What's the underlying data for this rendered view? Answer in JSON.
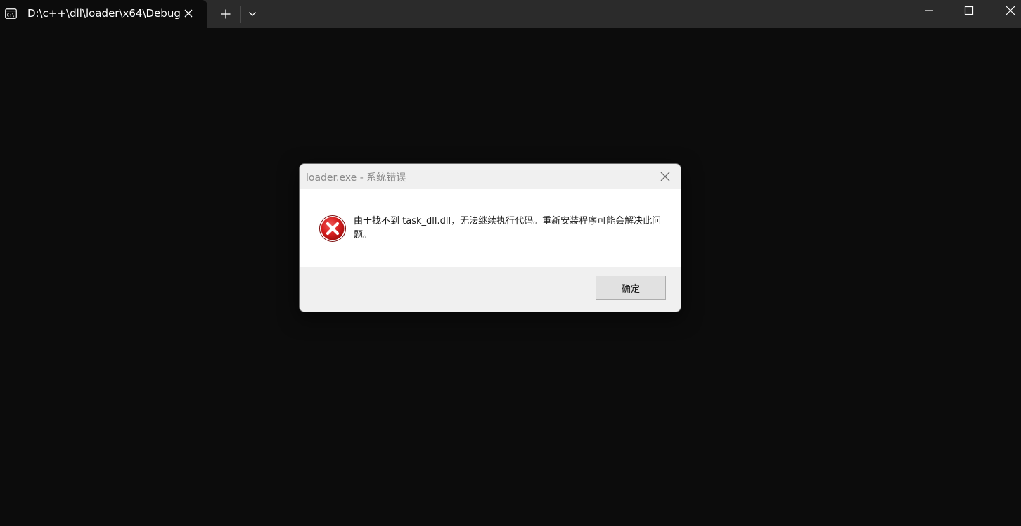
{
  "tab": {
    "title": "D:\\c++\\dll\\loader\\x64\\Debug",
    "icon": "terminal-icon"
  },
  "window_controls": {
    "minimize_icon": "minimize-icon",
    "maximize_icon": "maximize-icon",
    "close_icon": "close-icon"
  },
  "dialog": {
    "title": "loader.exe - 系统错误",
    "icon": "error-icon",
    "message": "由于找不到 task_dll.dll，无法继续执行代码。重新安装程序可能会解决此问题。",
    "ok_label": "确定"
  },
  "colors": {
    "terminal_bg": "#0c0c0c",
    "tabbar_bg": "#2b2b2b",
    "error_red": "#d61f1f"
  }
}
